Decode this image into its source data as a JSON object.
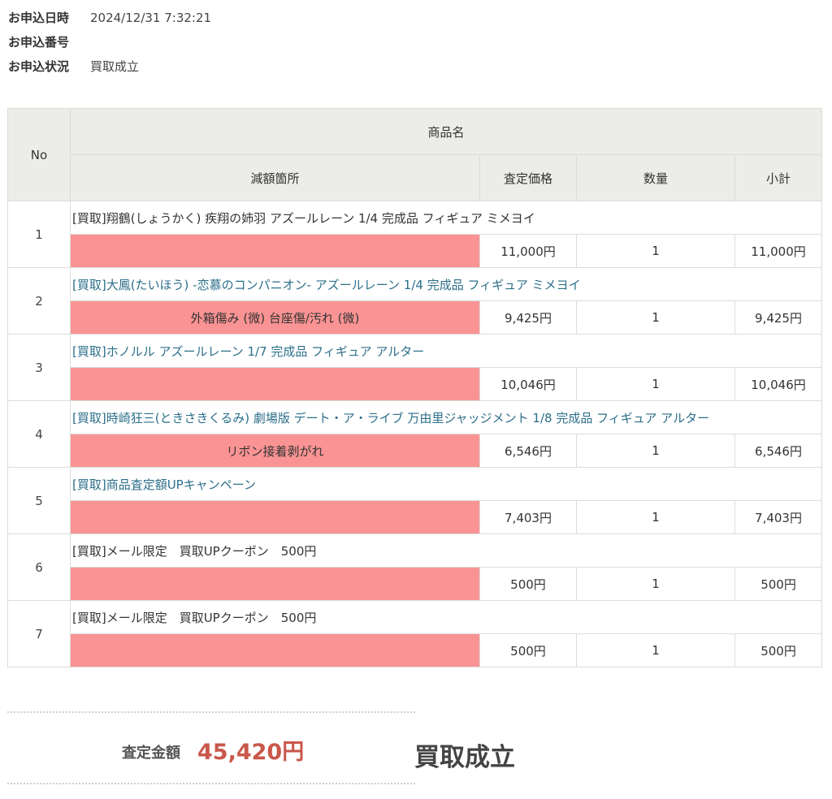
{
  "info": {
    "date_label": "お申込日時",
    "date_value": "2024/12/31 7:32:21",
    "number_label": "お申込番号",
    "number_value": "",
    "status_label": "お申込状況",
    "status_value": "買取成立"
  },
  "table": {
    "headers": {
      "no": "No",
      "product": "商品名",
      "reduction": "減額箇所",
      "price": "査定価格",
      "qty": "数量",
      "subtotal": "小計"
    },
    "rows": [
      {
        "no": "1",
        "name": "[買取]翔鶴(しょうかく) 疾翔の姉羽 アズールレーン 1/4 完成品 フィギュア ミメヨイ",
        "reduction": "",
        "price": "11,000円",
        "qty": "1",
        "subtotal": "11,000円"
      },
      {
        "no": "2",
        "name": "[買取]大鳳(たいほう) -恋慕のコンパニオン- アズールレーン 1/4 完成品 フィギュア ミメヨイ",
        "reduction": "外箱傷み (微) 台座傷/汚れ (微)",
        "price": "9,425円",
        "qty": "1",
        "subtotal": "9,425円"
      },
      {
        "no": "3",
        "name": "[買取]ホノルル アズールレーン 1/7 完成品 フィギュア アルター",
        "reduction": "",
        "price": "10,046円",
        "qty": "1",
        "subtotal": "10,046円"
      },
      {
        "no": "4",
        "name": "[買取]時崎狂三(ときさきくるみ) 劇場版 デート・ア・ライブ 万由里ジャッジメント 1/8 完成品 フィギュア アルター",
        "reduction": "リボン接着剥がれ",
        "price": "6,546円",
        "qty": "1",
        "subtotal": "6,546円"
      },
      {
        "no": "5",
        "name": "[買取]商品査定額UPキャンペーン",
        "reduction": "",
        "price": "7,403円",
        "qty": "1",
        "subtotal": "7,403円"
      },
      {
        "no": "6",
        "name": "[買取]メール限定　買取UPクーポン　500円",
        "reduction": "",
        "price": "500円",
        "qty": "1",
        "subtotal": "500円"
      },
      {
        "no": "7",
        "name": "[買取]メール限定　買取UPクーポン　500円",
        "reduction": "",
        "price": "500円",
        "qty": "1",
        "subtotal": "500円"
      }
    ]
  },
  "summary": {
    "label": "査定金額",
    "amount": "45,420円",
    "status": "買取成立"
  },
  "colors": {
    "reduction_bg": "#fa9393",
    "header_bg": "#ecece8",
    "link": "#2c6f8a",
    "amount": "#c9574a"
  }
}
